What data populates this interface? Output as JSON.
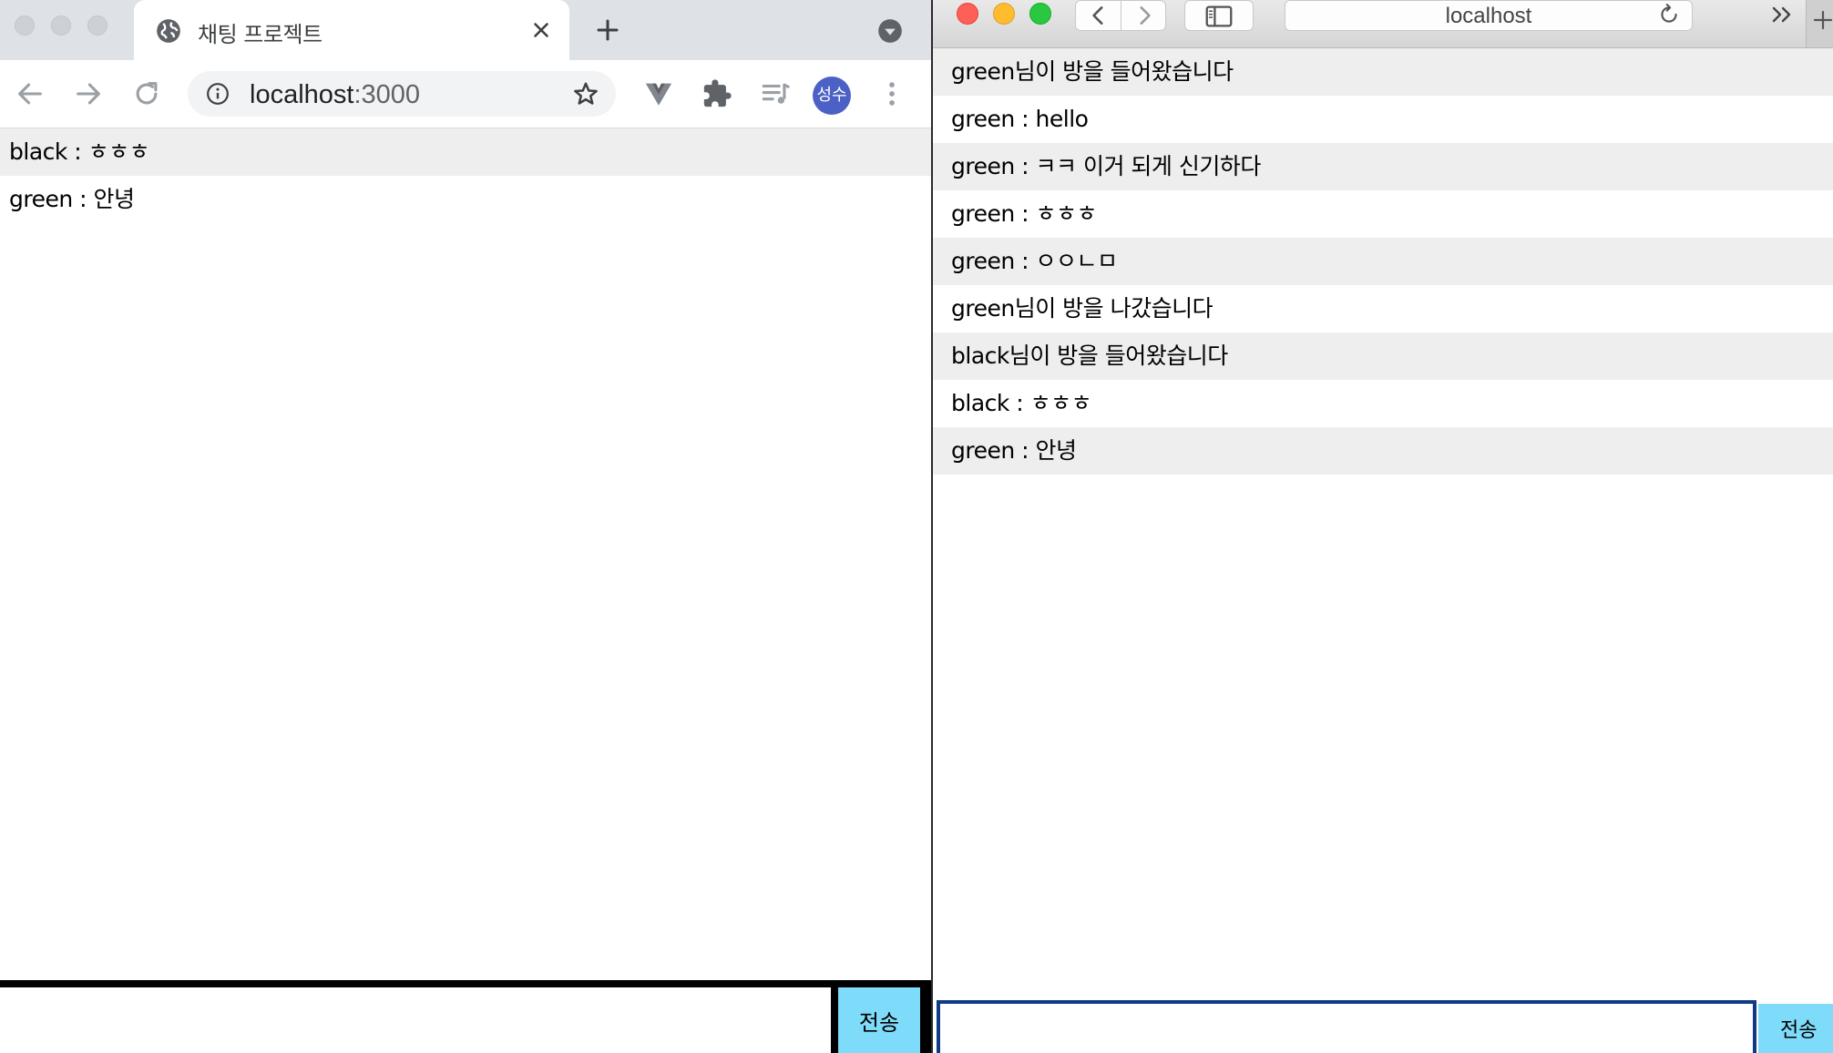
{
  "chrome": {
    "tab_title": "채팅 프로젝트",
    "url_host": "localhost",
    "url_port": ":3000",
    "profile_initials": "성수",
    "messages": [
      {
        "text": "black : ㅎㅎㅎ",
        "shaded": true
      },
      {
        "text": "green : 안녕",
        "shaded": false
      }
    ],
    "input_value": "",
    "send_label": "전송"
  },
  "safari": {
    "address": "localhost",
    "messages": [
      {
        "text": "green님이 방을 들어왔습니다",
        "shaded": true
      },
      {
        "text": "green : hello",
        "shaded": false
      },
      {
        "text": "green : ㅋㅋ 이거 되게 신기하다",
        "shaded": true
      },
      {
        "text": "green : ㅎㅎㅎ",
        "shaded": false
      },
      {
        "text": "green : ㅇㅇㄴㅁ",
        "shaded": true
      },
      {
        "text": "green님이 방을 나갔습니다",
        "shaded": false
      },
      {
        "text": "black님이 방을 들어왔습니다",
        "shaded": true
      },
      {
        "text": "black : ㅎㅎㅎ",
        "shaded": false
      },
      {
        "text": "green : 안녕",
        "shaded": true
      }
    ],
    "input_value": "",
    "send_label": "전송"
  },
  "icons": {
    "chrome": [
      "globe-icon",
      "close-icon",
      "plus-icon",
      "tab-search-icon",
      "back-arrow-icon",
      "forward-arrow-icon",
      "reload-icon",
      "info-icon",
      "star-icon",
      "vue-devtools-icon",
      "puzzle-icon",
      "media-queue-icon",
      "more-vert-icon"
    ],
    "safari": [
      "chevron-left-icon",
      "chevron-right-icon",
      "sidebar-icon",
      "reload-icon",
      "double-chevron-icon",
      "plus-icon"
    ]
  },
  "colors": {
    "chrome_tabstrip": "#dee1e6",
    "row_shade": "#eeeeee",
    "send_button": "#7fdbfa",
    "safari_input_border": "#0f3a86",
    "avatar": "#4c61c6"
  }
}
